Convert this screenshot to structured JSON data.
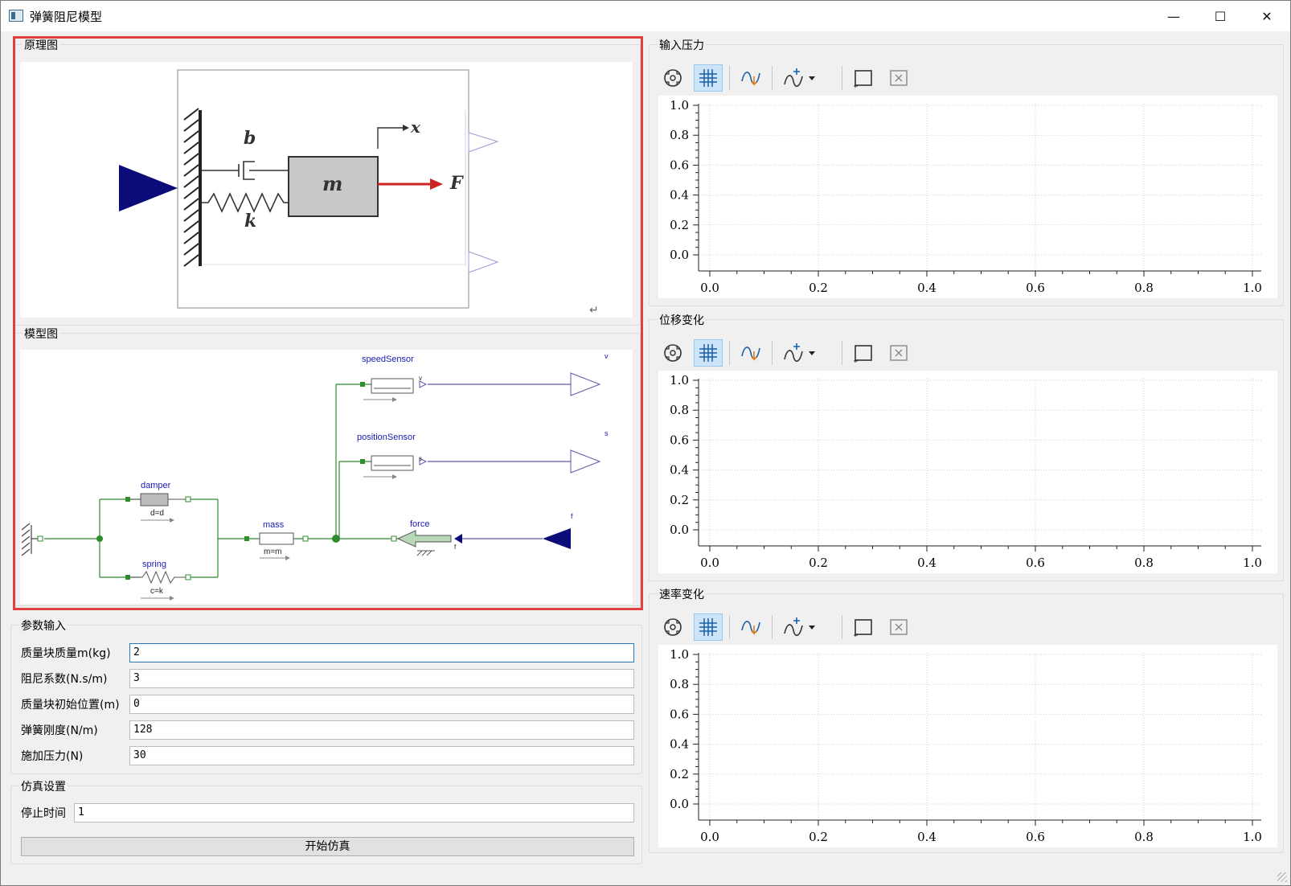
{
  "window": {
    "title": "弹簧阻尼模型",
    "min_glyph": "—",
    "max_glyph": "☐",
    "close_glyph": "✕"
  },
  "left": {
    "schematic": {
      "title": "原理图",
      "labels": {
        "b": "b",
        "k": "k",
        "m": "m",
        "F": "F",
        "x": "x"
      }
    },
    "model": {
      "title": "模型图",
      "labels": {
        "speedSensor": "speedSensor",
        "v_out": "v",
        "v_port": "v",
        "positionSensor": "positionSensor",
        "s_out": "s",
        "s_port": "s",
        "damper": "damper",
        "damper_param": "d=d",
        "spring": "spring",
        "spring_param": "c=k",
        "mass": "mass",
        "mass_param": "m=m",
        "force": "force",
        "f_out": "f",
        "f_port": "f"
      }
    },
    "params": {
      "title": "参数输入",
      "rows": [
        {
          "label": "质量块质量m(kg)",
          "value": "2"
        },
        {
          "label": "阻尼系数(N.s/m)",
          "value": "3"
        },
        {
          "label": "质量块初始位置(m)",
          "value": "0"
        },
        {
          "label": "弹簧刚度(N/m)",
          "value": "128"
        },
        {
          "label": "施加压力(N)",
          "value": "30"
        }
      ]
    },
    "sim": {
      "title": "仿真设置",
      "stop_label": "停止时间",
      "stop_value": "1",
      "start_button": "开始仿真"
    }
  },
  "charts": [
    {
      "title": "输入压力"
    },
    {
      "title": "位移变化"
    },
    {
      "title": "速率变化"
    }
  ],
  "chart_data": [
    {
      "type": "line",
      "x_ticks": [
        "0.0",
        "0.2",
        "0.4",
        "0.6",
        "0.8",
        "1.0"
      ],
      "y_ticks": [
        "1.0",
        "0.8",
        "0.6",
        "0.4",
        "0.2",
        "0.0"
      ],
      "xlim": [
        0,
        1
      ],
      "ylim": [
        0,
        1
      ],
      "grid": true,
      "series": []
    },
    {
      "type": "line",
      "x_ticks": [
        "0.0",
        "0.2",
        "0.4",
        "0.6",
        "0.8",
        "1.0"
      ],
      "y_ticks": [
        "1.0",
        "0.8",
        "0.6",
        "0.4",
        "0.2",
        "0.0"
      ],
      "xlim": [
        0,
        1
      ],
      "ylim": [
        0,
        1
      ],
      "grid": true,
      "series": []
    },
    {
      "type": "line",
      "x_ticks": [
        "0.0",
        "0.2",
        "0.4",
        "0.6",
        "0.8",
        "1.0"
      ],
      "y_ticks": [
        "1.0",
        "0.8",
        "0.6",
        "0.4",
        "0.2",
        "0.0"
      ],
      "xlim": [
        0,
        1
      ],
      "ylim": [
        0,
        1
      ],
      "grid": true,
      "series": []
    }
  ],
  "toolbar_icons": [
    "zoom-fit-icon",
    "grid-toggle-icon",
    "curve-pick-icon",
    "add-curve-icon",
    "dropdown-arrow-icon",
    "select-rect-icon",
    "clear-rect-icon"
  ],
  "colors": {
    "accent_red": "#e04040",
    "navy": "#0b0b7a",
    "wire_green": "#2e8b2e",
    "wire_blue": "#5a5aa8",
    "link_blue": "#1a1ab8"
  }
}
